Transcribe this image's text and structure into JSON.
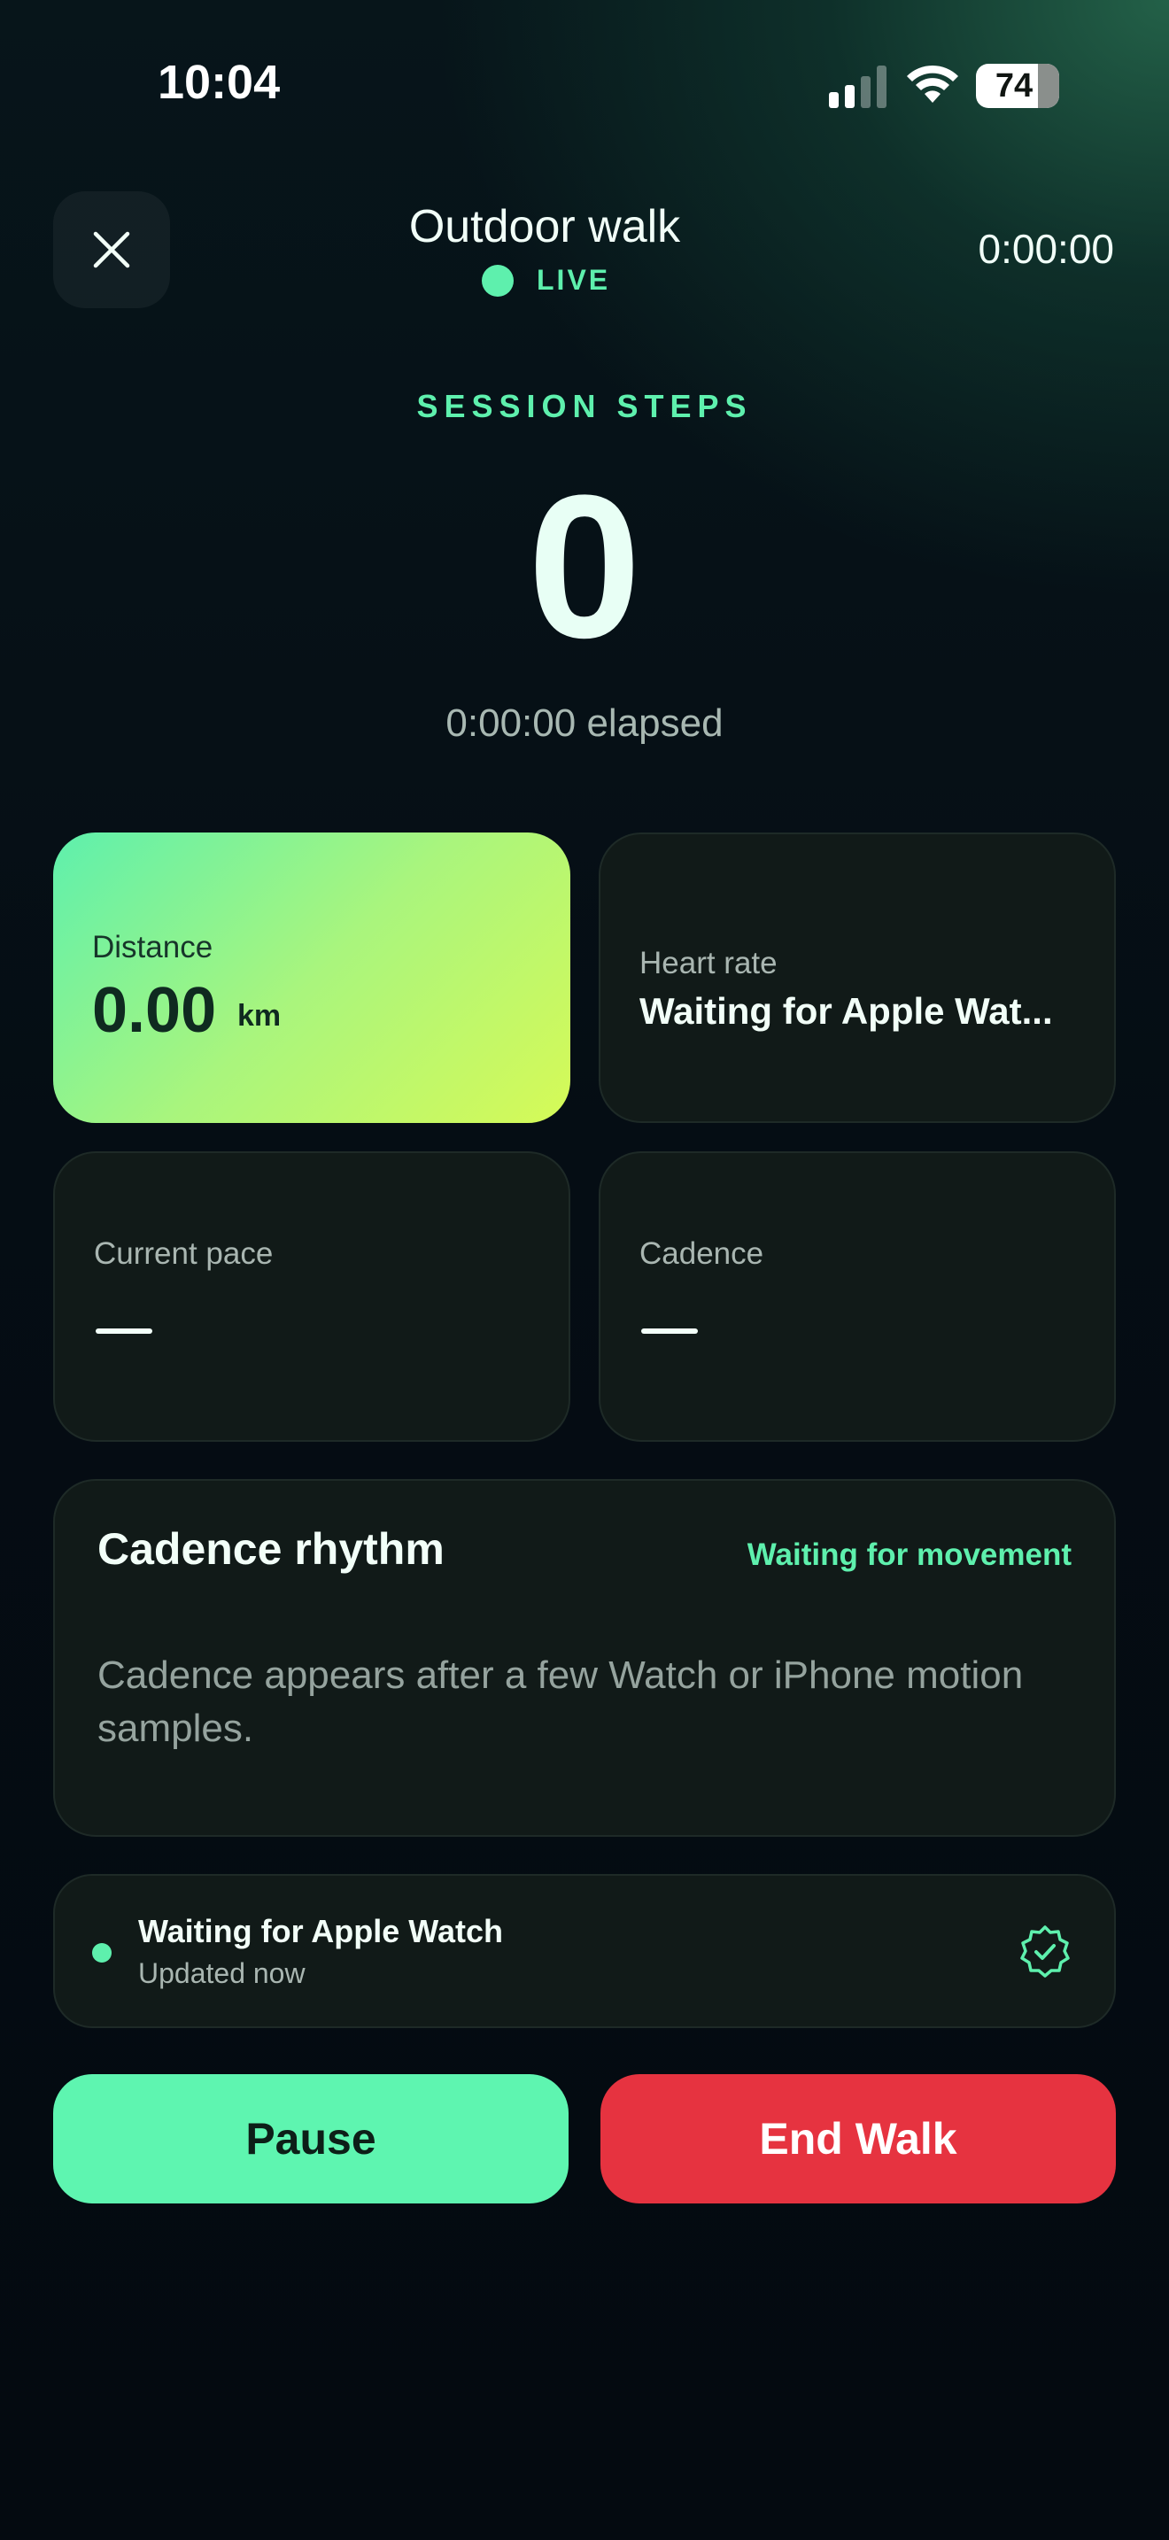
{
  "status_bar": {
    "time": "10:04",
    "battery": "74",
    "battery_level": 0.74
  },
  "header": {
    "title": "Outdoor walk",
    "live_label": "LIVE",
    "timer": "0:00:00",
    "close_icon": "close-icon"
  },
  "session": {
    "label": "SESSION STEPS",
    "steps": "0",
    "elapsed": "0:00:00 elapsed"
  },
  "metrics": {
    "distance": {
      "label": "Distance",
      "value": "0.00",
      "unit": "km"
    },
    "heart_rate": {
      "label": "Heart rate",
      "value": "Waiting for Apple Wat..."
    },
    "pace": {
      "label": "Current pace"
    },
    "cadence": {
      "label": "Cadence"
    }
  },
  "rhythm": {
    "title": "Cadence rhythm",
    "status": "Waiting for movement",
    "body": "Cadence appears after a few Watch or iPhone motion samples."
  },
  "watch_status": {
    "title": "Waiting for Apple Watch",
    "subtitle": "Updated now",
    "icon": "verified-badge-icon"
  },
  "actions": {
    "pause": "Pause",
    "end": "End Walk"
  },
  "colors": {
    "accent": "#5ef0ad",
    "danger": "#e63340",
    "card": "#111a18"
  }
}
